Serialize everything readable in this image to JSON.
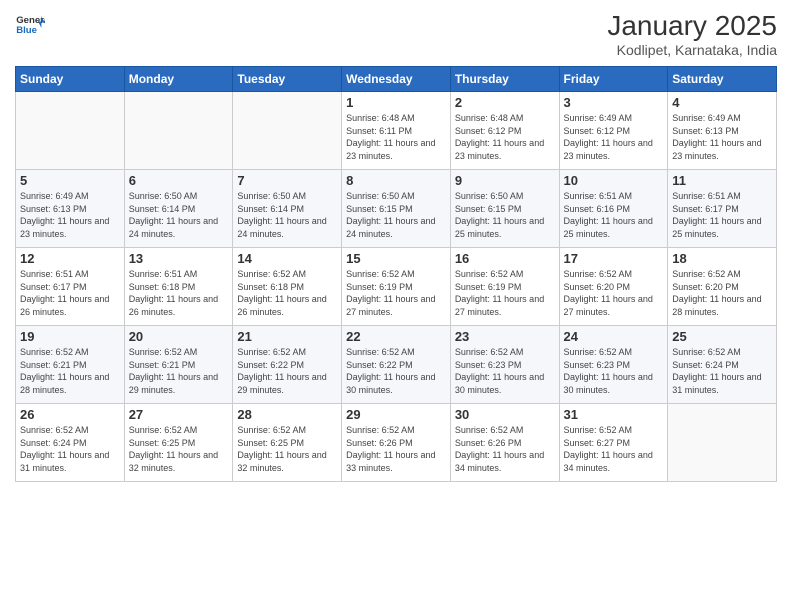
{
  "header": {
    "logo_general": "General",
    "logo_blue": "Blue",
    "title": "January 2025",
    "subtitle": "Kodlipet, Karnataka, India"
  },
  "weekdays": [
    "Sunday",
    "Monday",
    "Tuesday",
    "Wednesday",
    "Thursday",
    "Friday",
    "Saturday"
  ],
  "weeks": [
    [
      {
        "day": "",
        "info": ""
      },
      {
        "day": "",
        "info": ""
      },
      {
        "day": "",
        "info": ""
      },
      {
        "day": "1",
        "info": "Sunrise: 6:48 AM\nSunset: 6:11 PM\nDaylight: 11 hours and 23 minutes."
      },
      {
        "day": "2",
        "info": "Sunrise: 6:48 AM\nSunset: 6:12 PM\nDaylight: 11 hours and 23 minutes."
      },
      {
        "day": "3",
        "info": "Sunrise: 6:49 AM\nSunset: 6:12 PM\nDaylight: 11 hours and 23 minutes."
      },
      {
        "day": "4",
        "info": "Sunrise: 6:49 AM\nSunset: 6:13 PM\nDaylight: 11 hours and 23 minutes."
      }
    ],
    [
      {
        "day": "5",
        "info": "Sunrise: 6:49 AM\nSunset: 6:13 PM\nDaylight: 11 hours and 23 minutes."
      },
      {
        "day": "6",
        "info": "Sunrise: 6:50 AM\nSunset: 6:14 PM\nDaylight: 11 hours and 24 minutes."
      },
      {
        "day": "7",
        "info": "Sunrise: 6:50 AM\nSunset: 6:14 PM\nDaylight: 11 hours and 24 minutes."
      },
      {
        "day": "8",
        "info": "Sunrise: 6:50 AM\nSunset: 6:15 PM\nDaylight: 11 hours and 24 minutes."
      },
      {
        "day": "9",
        "info": "Sunrise: 6:50 AM\nSunset: 6:15 PM\nDaylight: 11 hours and 25 minutes."
      },
      {
        "day": "10",
        "info": "Sunrise: 6:51 AM\nSunset: 6:16 PM\nDaylight: 11 hours and 25 minutes."
      },
      {
        "day": "11",
        "info": "Sunrise: 6:51 AM\nSunset: 6:17 PM\nDaylight: 11 hours and 25 minutes."
      }
    ],
    [
      {
        "day": "12",
        "info": "Sunrise: 6:51 AM\nSunset: 6:17 PM\nDaylight: 11 hours and 26 minutes."
      },
      {
        "day": "13",
        "info": "Sunrise: 6:51 AM\nSunset: 6:18 PM\nDaylight: 11 hours and 26 minutes."
      },
      {
        "day": "14",
        "info": "Sunrise: 6:52 AM\nSunset: 6:18 PM\nDaylight: 11 hours and 26 minutes."
      },
      {
        "day": "15",
        "info": "Sunrise: 6:52 AM\nSunset: 6:19 PM\nDaylight: 11 hours and 27 minutes."
      },
      {
        "day": "16",
        "info": "Sunrise: 6:52 AM\nSunset: 6:19 PM\nDaylight: 11 hours and 27 minutes."
      },
      {
        "day": "17",
        "info": "Sunrise: 6:52 AM\nSunset: 6:20 PM\nDaylight: 11 hours and 27 minutes."
      },
      {
        "day": "18",
        "info": "Sunrise: 6:52 AM\nSunset: 6:20 PM\nDaylight: 11 hours and 28 minutes."
      }
    ],
    [
      {
        "day": "19",
        "info": "Sunrise: 6:52 AM\nSunset: 6:21 PM\nDaylight: 11 hours and 28 minutes."
      },
      {
        "day": "20",
        "info": "Sunrise: 6:52 AM\nSunset: 6:21 PM\nDaylight: 11 hours and 29 minutes."
      },
      {
        "day": "21",
        "info": "Sunrise: 6:52 AM\nSunset: 6:22 PM\nDaylight: 11 hours and 29 minutes."
      },
      {
        "day": "22",
        "info": "Sunrise: 6:52 AM\nSunset: 6:22 PM\nDaylight: 11 hours and 30 minutes."
      },
      {
        "day": "23",
        "info": "Sunrise: 6:52 AM\nSunset: 6:23 PM\nDaylight: 11 hours and 30 minutes."
      },
      {
        "day": "24",
        "info": "Sunrise: 6:52 AM\nSunset: 6:23 PM\nDaylight: 11 hours and 30 minutes."
      },
      {
        "day": "25",
        "info": "Sunrise: 6:52 AM\nSunset: 6:24 PM\nDaylight: 11 hours and 31 minutes."
      }
    ],
    [
      {
        "day": "26",
        "info": "Sunrise: 6:52 AM\nSunset: 6:24 PM\nDaylight: 11 hours and 31 minutes."
      },
      {
        "day": "27",
        "info": "Sunrise: 6:52 AM\nSunset: 6:25 PM\nDaylight: 11 hours and 32 minutes."
      },
      {
        "day": "28",
        "info": "Sunrise: 6:52 AM\nSunset: 6:25 PM\nDaylight: 11 hours and 32 minutes."
      },
      {
        "day": "29",
        "info": "Sunrise: 6:52 AM\nSunset: 6:26 PM\nDaylight: 11 hours and 33 minutes."
      },
      {
        "day": "30",
        "info": "Sunrise: 6:52 AM\nSunset: 6:26 PM\nDaylight: 11 hours and 34 minutes."
      },
      {
        "day": "31",
        "info": "Sunrise: 6:52 AM\nSunset: 6:27 PM\nDaylight: 11 hours and 34 minutes."
      },
      {
        "day": "",
        "info": ""
      }
    ]
  ]
}
